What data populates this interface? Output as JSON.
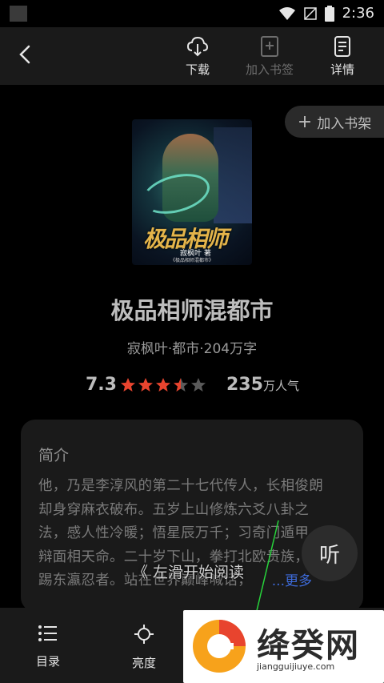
{
  "status_bar": {
    "time": "2:36"
  },
  "toolbar": {
    "download_label": "下载",
    "bookmark_label": "加入书签",
    "details_label": "详情"
  },
  "add_shelf_label": "加入书架",
  "book": {
    "cover_title": "极品相师",
    "cover_author": "寂枫叶 著",
    "cover_footer": "《极品相师混都市》",
    "title": "极品相师混都市",
    "meta": "寂枫叶·都市·204万字",
    "score": "7.3",
    "rating_stars": 3.5,
    "rating_max": 5,
    "popularity_num": "235",
    "popularity_unit": "万人气"
  },
  "intro": {
    "heading": "简介",
    "lines": [
      "他，乃是李淳风的第二十七代传人，长相俊朗",
      "却身穿麻衣破布。五岁上山修炼六爻八卦之",
      "法，感人性冷暖；悟星辰万千；习奇门遁甲，",
      "辩面相天命。二十岁下山，拳打北欧贵族，",
      "踢东瀛忍者。站在世界巅峰喊话，"
    ],
    "more_label": "...更多"
  },
  "swipe_hint": "《 左滑开始阅读",
  "listen_label": "听",
  "bottom_bar": {
    "toc_label": "目录",
    "brightness_label": "亮度"
  },
  "watermark": {
    "title": "绛癸网",
    "url": "jiangguijiuye.com"
  },
  "colors": {
    "background": "#000000",
    "panel": "#1a1a1a",
    "star_active": "#e8442e",
    "star_inactive": "#5a5a5a",
    "link": "#3d6ad8"
  }
}
